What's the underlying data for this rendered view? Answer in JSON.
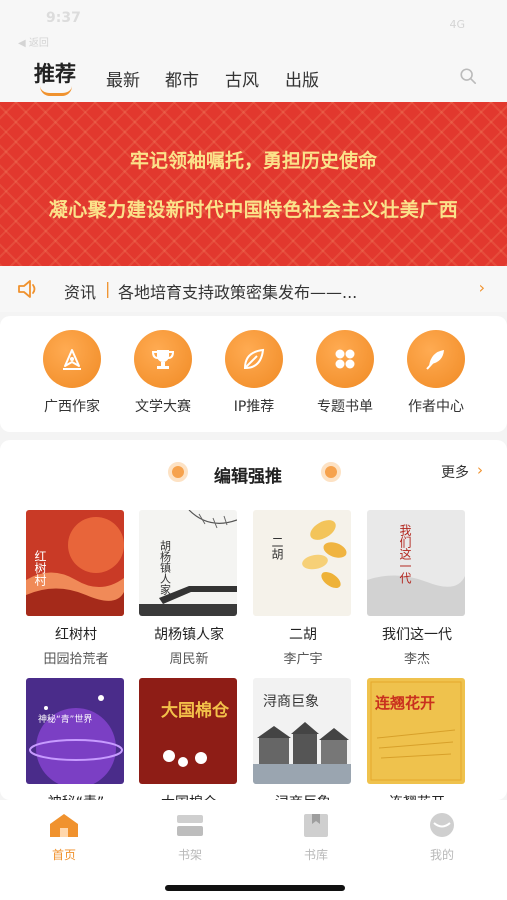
{
  "status": {
    "time": "9:37",
    "back": "◀ 返回",
    "right": "4G"
  },
  "nav": {
    "active": "推荐",
    "tabs": [
      "最新",
      "都市",
      "古风",
      "出版"
    ]
  },
  "banner": {
    "line1": "牢记领袖嘱托，勇担历史使命",
    "line2": "凝心聚力建设新时代中国特色社会主义壮美广西"
  },
  "news": {
    "tag": "资讯",
    "separator": "|",
    "headline": "各地培育支持政策密集发布——..."
  },
  "categories": [
    "广西作家",
    "文学大赛",
    "IP推荐",
    "专题书单",
    "作者中心"
  ],
  "editor_section": {
    "title": "编辑强推",
    "more": "更多"
  },
  "books": [
    {
      "title": "红树村",
      "author": "田园拾荒者",
      "cover_text": "红树村"
    },
    {
      "title": "胡杨镇人家",
      "author": "周民新",
      "cover_text": "胡杨镇人家"
    },
    {
      "title": "二胡",
      "author": "李广宇",
      "cover_text": "二胡"
    },
    {
      "title": "我们这一代",
      "author": "李杰",
      "cover_text": "我们这一代"
    },
    {
      "title": "神秘“青”",
      "author": "",
      "cover_text": "神秘“青”世界"
    },
    {
      "title": "大国棉仓",
      "author": "",
      "cover_text": "大国棉仓"
    },
    {
      "title": "浔商巨象",
      "author": "",
      "cover_text": "浔商巨象"
    },
    {
      "title": "连翘花开",
      "author": "",
      "cover_text": "连翘花开"
    }
  ],
  "tabbar": [
    "首页",
    "书架",
    "书库",
    "我的"
  ],
  "colors": {
    "accent": "#f0922e",
    "banner_red": "#e2382e",
    "banner_text": "#fbe28a"
  }
}
